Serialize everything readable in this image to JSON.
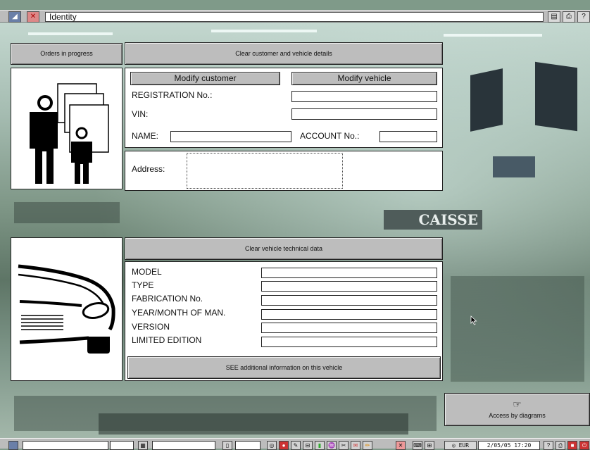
{
  "window": {
    "title": "Identity"
  },
  "sidebar": {
    "orders_label": "Orders in progress"
  },
  "customer": {
    "clear_label": "Clear customer and vehicle details",
    "modify_customer_label": "Modify customer",
    "modify_vehicle_label": "Modify vehicle",
    "registration_label": "REGISTRATION No.:",
    "registration_value": "",
    "vin_label": "VIN:",
    "vin_value": "",
    "name_label": "NAME:",
    "name_value": "",
    "account_label": "ACCOUNT No.:",
    "account_value": "",
    "address_label": "Address:",
    "address_value": ""
  },
  "vehicle": {
    "clear_label": "Clear vehicle technical data",
    "model_label": "MODEL",
    "type_label": "TYPE",
    "fabrication_label": "FABRICATION No.",
    "year_label": "YEAR/MONTH OF MAN.",
    "version_label": "VERSION",
    "limited_label": "LIMITED EDITION",
    "model_value": "",
    "type_value": "",
    "fabrication_value": "",
    "year_value": "",
    "version_value": "",
    "limited_value": "",
    "see_more_label": "SEE additional information on this vehicle"
  },
  "diagrams": {
    "label": "Access by diagrams",
    "icon": "pointing-hand-icon"
  },
  "background": {
    "sign_text": "CAISSE"
  },
  "statusbar": {
    "currency": "EUR",
    "datetime": "2/05/05  17:20"
  },
  "colors": {
    "button_gray": "#bdbdbd",
    "panel_white": "#ffffff",
    "bar_gray": "#bcbcbc"
  }
}
